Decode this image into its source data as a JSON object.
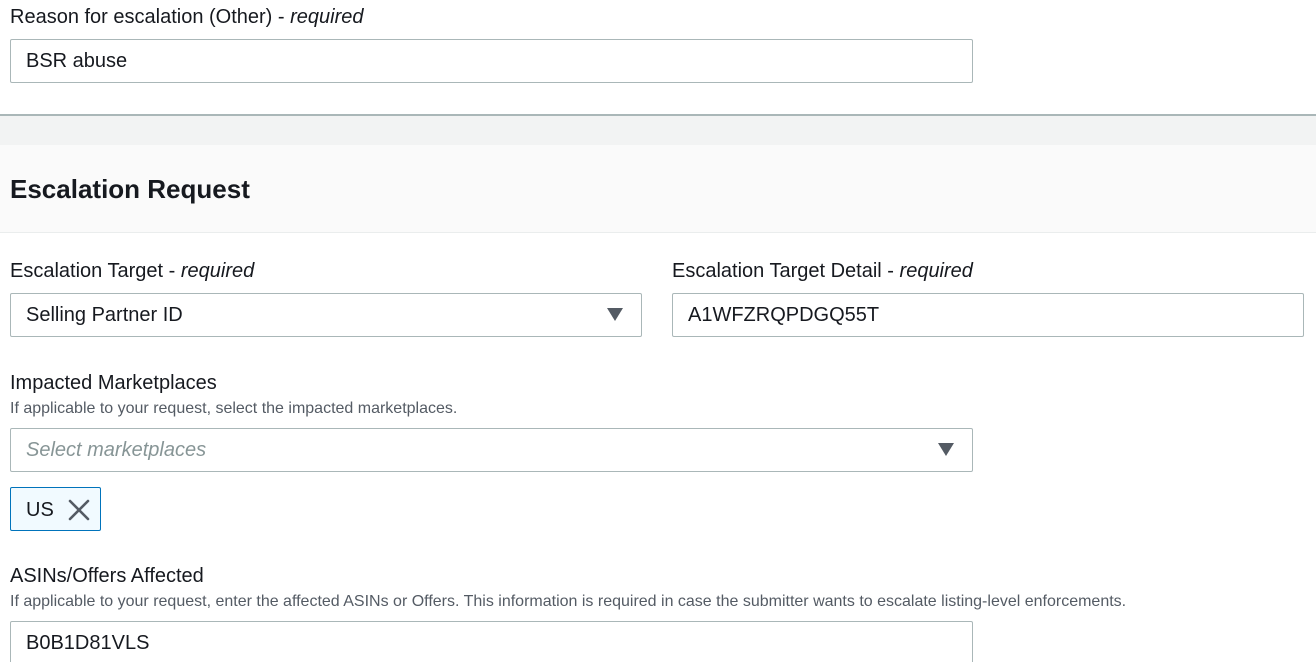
{
  "reason": {
    "label": "Reason for escalation (Other)",
    "required_text": "required",
    "value": "BSR abuse"
  },
  "section": {
    "title": "Escalation Request"
  },
  "escalation_target": {
    "label": "Escalation Target",
    "required_text": "required",
    "selected": "Selling Partner ID"
  },
  "escalation_target_detail": {
    "label": "Escalation Target Detail",
    "required_text": "required",
    "value": "A1WFZRQPDGQ55T"
  },
  "marketplaces": {
    "label": "Impacted Marketplaces",
    "description": "If applicable to your request, select the impacted marketplaces.",
    "placeholder": "Select marketplaces",
    "tokens": [
      "US"
    ]
  },
  "asins": {
    "label": "ASINs/Offers Affected",
    "description": "If applicable to your request, enter the affected ASINs or Offers. This information is required in case the submitter wants to escalate listing-level enforcements.",
    "value": "B0B1D81VLS"
  },
  "colors": {
    "text": "#16191f",
    "secondary_text": "#545b64",
    "border": "#aab7b8",
    "token_border": "#0073bb",
    "token_background": "#f1faff"
  },
  "icons": {
    "dropdown": "caret-down-icon",
    "token_remove": "close-icon"
  }
}
